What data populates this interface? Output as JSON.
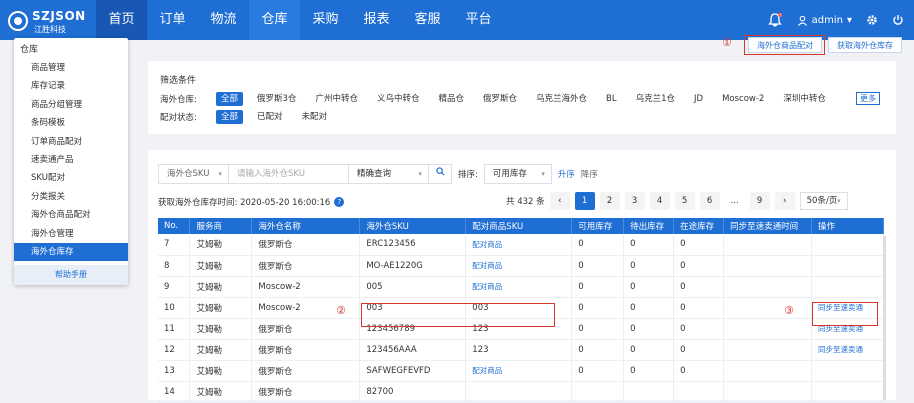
{
  "brand": {
    "name": "SZJSON",
    "sub": "江胜科技"
  },
  "nav": [
    "首页",
    "订单",
    "物流",
    "仓库",
    "采购",
    "报表",
    "客服",
    "平台"
  ],
  "user": {
    "name": "admin"
  },
  "toolbar": {
    "btn1": "海外仓商品配对",
    "btn2": "获取海外仓库存",
    "ann1": "①",
    "ann2": "②",
    "ann3": "③"
  },
  "menu": {
    "title": "仓库",
    "items": [
      "商品管理",
      "库存记录",
      "商品分组管理",
      "条码模板",
      "订单商品配对",
      "速卖通产品",
      "SKU配对",
      "分类报关",
      "海外仓商品配对",
      "海外仓管理",
      "海外仓库存"
    ],
    "help": "帮助手册"
  },
  "filter": {
    "title": "筛选条件",
    "warehouse_label": "海外仓库:",
    "warehouses": [
      "全部",
      "俄罗斯3仓",
      "广州中转仓",
      "义乌中转仓",
      "精品仓",
      "俄罗斯仓",
      "乌克兰海外仓",
      "BL",
      "乌克兰1仓",
      "JD",
      "Moscow-2",
      "深圳中转仓"
    ],
    "more": "更多",
    "status_label": "配对状态:",
    "statuses": [
      "全部",
      "已配对",
      "未配对"
    ]
  },
  "search": {
    "field": "海外仓SKU",
    "placeholder": "请输入海外仓SKU",
    "mode": "精确查询",
    "sort_label": "排序:",
    "sort_field": "可用库存",
    "asc": "升序",
    "desc": "降序"
  },
  "info": {
    "fetched": "获取海外仓库存时间: 2020-05-20 16:00:16"
  },
  "pager": {
    "total": "共 432 条",
    "pages": [
      "1",
      "2",
      "3",
      "4",
      "5",
      "6",
      "...",
      "9"
    ],
    "size": "50条/页"
  },
  "table": {
    "headers": [
      "No.",
      "服务商",
      "海外仓名称",
      "海外仓SKU",
      "配对商品SKU",
      "可用库存",
      "待出库存",
      "在途库存",
      "同步至速卖通时间",
      "操作"
    ],
    "rows": [
      [
        "7",
        "艾姆勒",
        "俄罗斯仓",
        "ERC123456",
        "配对商品",
        "0",
        "0",
        "0",
        "",
        ""
      ],
      [
        "8",
        "艾姆勒",
        "俄罗斯仓",
        "MO-AE1220G",
        "配对商品",
        "0",
        "0",
        "0",
        "",
        ""
      ],
      [
        "9",
        "艾姆勒",
        "Moscow-2",
        "005",
        "配对商品",
        "0",
        "0",
        "0",
        "",
        ""
      ],
      [
        "10",
        "艾姆勒",
        "Moscow-2",
        "003",
        "003",
        "0",
        "0",
        "0",
        "",
        "同步至速卖通"
      ],
      [
        "11",
        "艾姆勒",
        "俄罗斯仓",
        "123456789",
        "123",
        "0",
        "0",
        "0",
        "",
        "同步至速卖通"
      ],
      [
        "12",
        "艾姆勒",
        "俄罗斯仓",
        "123456AAA",
        "123",
        "0",
        "0",
        "0",
        "",
        "同步至速卖通"
      ],
      [
        "13",
        "艾姆勒",
        "俄罗斯仓",
        "SAFWEGFEVFD",
        "配对商品",
        "0",
        "0",
        "0",
        "",
        ""
      ],
      [
        "14",
        "艾姆勒",
        "俄罗斯仓",
        "82700",
        "",
        "",
        "",
        "",
        "",
        ""
      ]
    ]
  }
}
